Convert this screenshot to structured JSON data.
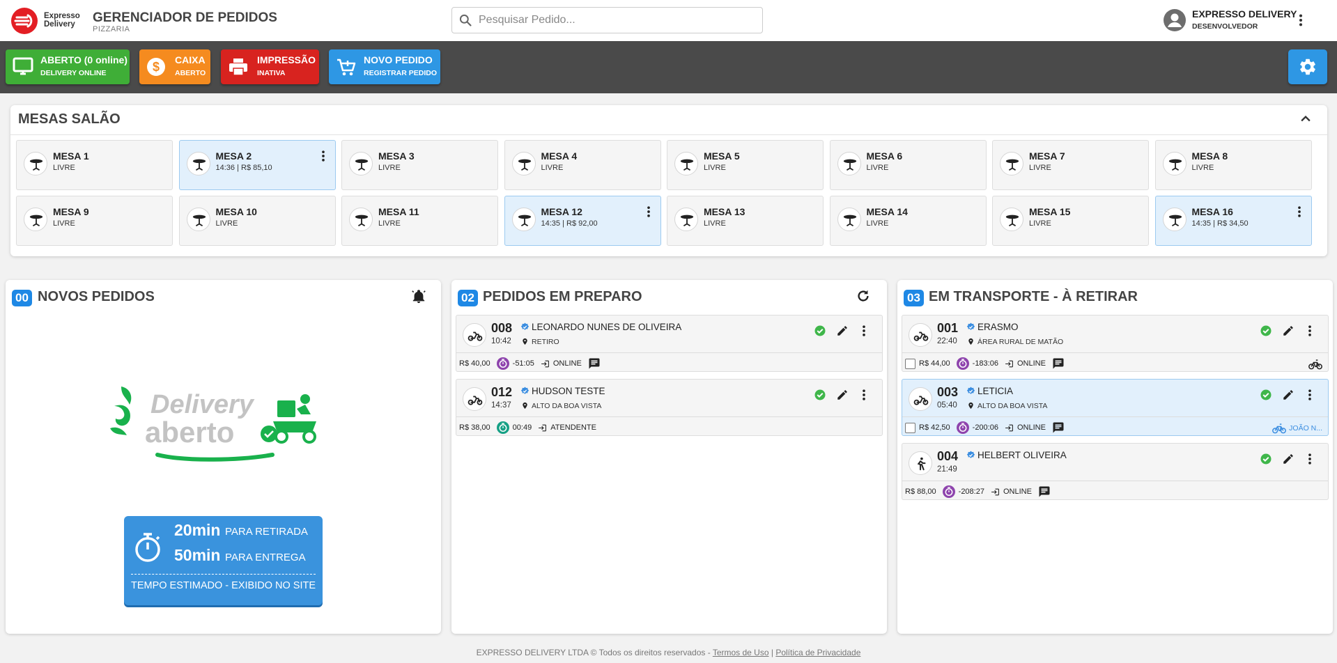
{
  "header": {
    "logo_line1": "Expresso",
    "logo_line2": "Delivery",
    "title": "GERENCIADOR DE PEDIDOS",
    "subtitle": "PIZZARIA",
    "search_placeholder": "Pesquisar Pedido...",
    "user_name": "EXPRESSO DELIVERY",
    "user_role": "DESENVOLVEDOR"
  },
  "toolbar": {
    "buttons": [
      {
        "title": "ABERTO (0 online)",
        "sub": "DELIVERY ONLINE",
        "color": "#3fae37",
        "icon": "monitor-icon"
      },
      {
        "title": "CAIXA",
        "sub": "ABERTO",
        "color": "#f58b1f",
        "icon": "dollar-icon"
      },
      {
        "title": "IMPRESSÃO",
        "sub": "INATIVA",
        "color": "#d8231f",
        "icon": "printer-icon"
      },
      {
        "title": "NOVO PEDIDO",
        "sub": "REGISTRAR PEDIDO",
        "color": "#2e97e4",
        "icon": "cart-add-icon"
      }
    ],
    "settings_color": "#2e97e4"
  },
  "salao": {
    "title": "MESAS SALÃO",
    "mesas": [
      {
        "name": "MESA 1",
        "status": "LIVRE",
        "busy": false
      },
      {
        "name": "MESA 2",
        "status": "14:36 | R$ 85,10",
        "busy": true
      },
      {
        "name": "MESA 3",
        "status": "LIVRE",
        "busy": false
      },
      {
        "name": "MESA 4",
        "status": "LIVRE",
        "busy": false
      },
      {
        "name": "MESA 5",
        "status": "LIVRE",
        "busy": false
      },
      {
        "name": "MESA 6",
        "status": "LIVRE",
        "busy": false
      },
      {
        "name": "MESA 7",
        "status": "LIVRE",
        "busy": false
      },
      {
        "name": "MESA 8",
        "status": "LIVRE",
        "busy": false
      },
      {
        "name": "MESA 9",
        "status": "LIVRE",
        "busy": false
      },
      {
        "name": "MESA 10",
        "status": "LIVRE",
        "busy": false
      },
      {
        "name": "MESA 11",
        "status": "LIVRE",
        "busy": false
      },
      {
        "name": "MESA 12",
        "status": "14:35 | R$ 92,00",
        "busy": true
      },
      {
        "name": "MESA 13",
        "status": "LIVRE",
        "busy": false
      },
      {
        "name": "MESA 14",
        "status": "LIVRE",
        "busy": false
      },
      {
        "name": "MESA 15",
        "status": "LIVRE",
        "busy": false
      },
      {
        "name": "MESA 16",
        "status": "14:35 | R$ 34,50",
        "busy": true
      }
    ]
  },
  "novos": {
    "count": "00",
    "title": "NOVOS PEDIDOS",
    "promo_line1": "Delivery",
    "promo_line2": "aberto",
    "estimate": {
      "retirada_time": "20min",
      "retirada_label": "PARA RETIRADA",
      "entrega_time": "50min",
      "entrega_label": "PARA ENTREGA",
      "footer": "TEMPO ESTIMADO - EXIBIDO NO SITE"
    }
  },
  "preparo": {
    "count": "02",
    "title": "PEDIDOS EM PREPARO",
    "orders": [
      {
        "num": "008",
        "time": "10:42",
        "name": "LEONARDO NUNES DE OLIVEIRA",
        "address": "RETIRO",
        "price": "R$ 40,00",
        "timer": "-51:05",
        "timer_color": "#8e44ad",
        "source": "ONLINE",
        "icon": "motorcycle-icon",
        "message": true
      },
      {
        "num": "012",
        "time": "14:37",
        "name": "HUDSON TESTE",
        "address": "ALTO DA BOA VISTA",
        "price": "R$ 38,00",
        "timer": "00:49",
        "timer_color": "#16a085",
        "source": "ATENDENTE",
        "icon": "motorcycle-icon",
        "message": false
      }
    ]
  },
  "transporte": {
    "count": "03",
    "title": "EM TRANSPORTE - À RETIRAR",
    "orders": [
      {
        "num": "001",
        "time": "22:40",
        "name": "ERASMO",
        "address": "ÁREA RURAL DE MATÃO",
        "price": "R$ 44,00",
        "timer": "-183:06",
        "timer_color": "#8e44ad",
        "source": "ONLINE",
        "icon": "motorcycle-icon",
        "checkbox": true,
        "rider": ""
      },
      {
        "num": "003",
        "time": "05:40",
        "name": "LETICIA",
        "address": "ALTO DA BOA VISTA",
        "price": "R$ 42,50",
        "timer": "-200:06",
        "timer_color": "#8e44ad",
        "source": "ONLINE",
        "icon": "motorcycle-icon",
        "checkbox": true,
        "rider": "JOÃO N..."
      },
      {
        "num": "004",
        "time": "21:49",
        "name": "HELBERT OLIVEIRA",
        "address": "",
        "price": "R$ 88,00",
        "timer": "-208:27",
        "timer_color": "#8e44ad",
        "source": "ONLINE",
        "icon": "walking-icon",
        "checkbox": false,
        "rider": ""
      }
    ]
  },
  "footer": {
    "copyright": "EXPRESSO DELIVERY LTDA © Todos os direitos reservados - ",
    "terms": "Termos de Uso",
    "separator": " | ",
    "privacy": "Política de Privacidade"
  }
}
